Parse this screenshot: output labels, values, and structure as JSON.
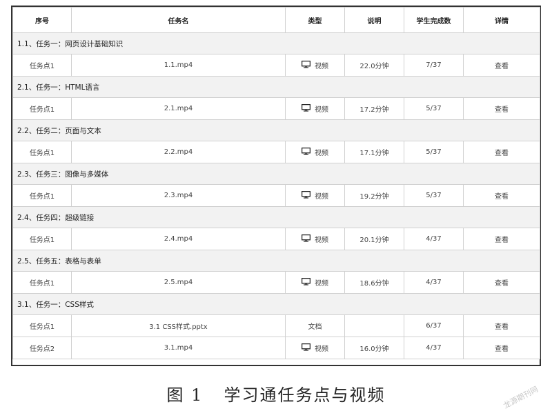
{
  "headers": [
    "序号",
    "任务名",
    "类型",
    "说明",
    "学生完成数",
    "详情"
  ],
  "rows": [
    {
      "kind": "section",
      "label": "1.1、任务一：网页设计基础知识"
    },
    {
      "kind": "item",
      "index": "任务点1",
      "name": "1.1.mp4",
      "type": "视频",
      "icon": "monitor-icon",
      "desc": "22.0分钟",
      "done": "7/37",
      "detail": "查看"
    },
    {
      "kind": "section",
      "label": "2.1、任务一：HTML语言"
    },
    {
      "kind": "item",
      "index": "任务点1",
      "name": "2.1.mp4",
      "type": "视频",
      "icon": "monitor-icon",
      "desc": "17.2分钟",
      "done": "5/37",
      "detail": "查看"
    },
    {
      "kind": "section",
      "label": "2.2、任务二：页面与文本"
    },
    {
      "kind": "item",
      "index": "任务点1",
      "name": "2.2.mp4",
      "type": "视频",
      "icon": "monitor-icon",
      "desc": "17.1分钟",
      "done": "5/37",
      "detail": "查看"
    },
    {
      "kind": "section",
      "label": "2.3、任务三：图像与多媒体"
    },
    {
      "kind": "item",
      "index": "任务点1",
      "name": "2.3.mp4",
      "type": "视频",
      "icon": "monitor-icon",
      "desc": "19.2分钟",
      "done": "5/37",
      "detail": "查看"
    },
    {
      "kind": "section",
      "label": "2.4、任务四：超级链接"
    },
    {
      "kind": "item",
      "index": "任务点1",
      "name": "2.4.mp4",
      "type": "视频",
      "icon": "monitor-icon",
      "desc": "20.1分钟",
      "done": "4/37",
      "detail": "查看"
    },
    {
      "kind": "section",
      "label": "2.5、任务五：表格与表单"
    },
    {
      "kind": "item",
      "index": "任务点1",
      "name": "2.5.mp4",
      "type": "视频",
      "icon": "monitor-icon",
      "desc": "18.6分钟",
      "done": "4/37",
      "detail": "查看"
    },
    {
      "kind": "section",
      "label": "3.1、任务一：CSS样式"
    },
    {
      "kind": "item",
      "index": "任务点1",
      "name": "3.1 CSS样式.pptx",
      "type": "文档",
      "icon": "",
      "desc": "",
      "done": "6/37",
      "detail": "查看"
    },
    {
      "kind": "item",
      "index": "任务点2",
      "name": "3.1.mp4",
      "type": "视频",
      "icon": "monitor-icon",
      "desc": "16.0分钟",
      "done": "4/37",
      "detail": "查看"
    }
  ],
  "caption": {
    "figure": "图 1",
    "title": "学习通任务点与视频"
  },
  "watermark": "龙源期刊网"
}
